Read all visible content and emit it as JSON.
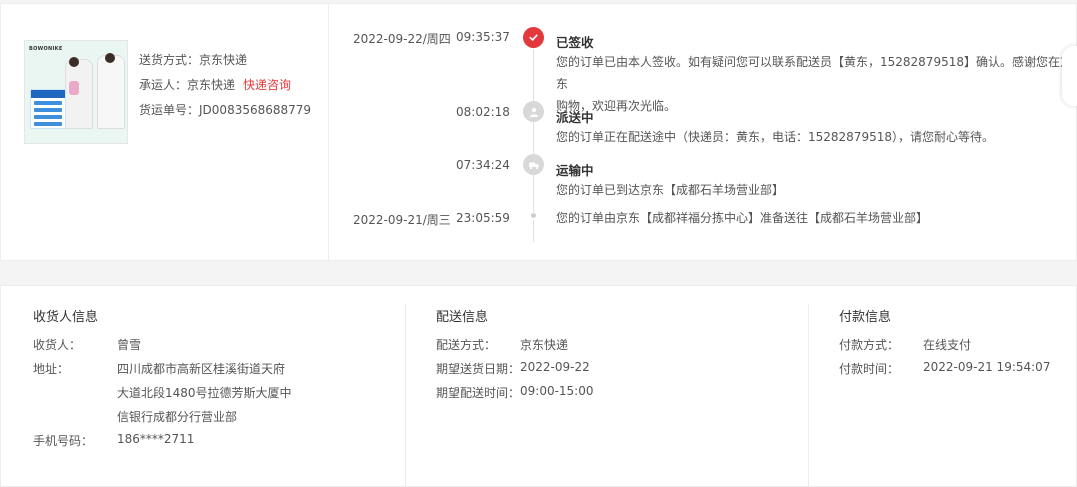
{
  "shipment": {
    "method_label": "送货方式：",
    "method_value": "京东快递",
    "carrier_label": "承运人：",
    "carrier_value": "京东快递",
    "consult_link": "快递咨询",
    "waybill_label": "货运单号：",
    "waybill_value": "JD0083568688779",
    "thumb_brand": "BOWONIKE"
  },
  "timeline": [
    {
      "date": "2022-09-22/周四",
      "time": "09:35:37",
      "status": "已签收",
      "icon": "check-icon",
      "desc_line1": "您的订单已由本人签收。如有疑问您可以联系配送员【黄东，15282879518】确认。感谢您在京东",
      "desc_line2": "购物，欢迎再次光临。"
    },
    {
      "date": "",
      "time": "08:02:18",
      "status": "派送中",
      "icon": "delivery-person-icon",
      "desc_line1": "您的订单正在配送途中（快递员：黄东，电话：15282879518），请您耐心等待。"
    },
    {
      "date": "",
      "time": "07:34:24",
      "status": "运输中",
      "icon": "truck-icon",
      "desc_line1": "您的订单已到达京东【成都石羊场营业部】"
    },
    {
      "date": "2022-09-21/周三",
      "time": "23:05:59",
      "status": "",
      "icon": "dot-icon",
      "desc_line1": "您的订单由京东【成都祥福分拣中心】准备送往【成都石羊场营业部】"
    }
  ],
  "consignee": {
    "title": "收货人信息",
    "name_label": "收货人：",
    "name_value": "曾雪",
    "address_label": "地址：",
    "address_line1": "四川成都市高新区桂溪街道天府",
    "address_line2": "大道北段1480号拉德芳斯大厦中",
    "address_line3": "信银行成都分行营业部",
    "phone_label": "手机号码：",
    "phone_value": "186****2711"
  },
  "delivery": {
    "title": "配送信息",
    "method_label": "配送方式：",
    "method_value": "京东快递",
    "date_label": "期望送货日期：",
    "date_value": "2022-09-22",
    "time_label": "期望配送时间：",
    "time_value": "09:00-15:00"
  },
  "payment": {
    "title": "付款信息",
    "method_label": "付款方式：",
    "method_value": "在线支付",
    "time_label": "付款时间：",
    "time_value": "2022-09-21 19:54:07"
  },
  "colors": {
    "accent_red": "#e4393c",
    "icon_grey": "#d8d8d8"
  }
}
